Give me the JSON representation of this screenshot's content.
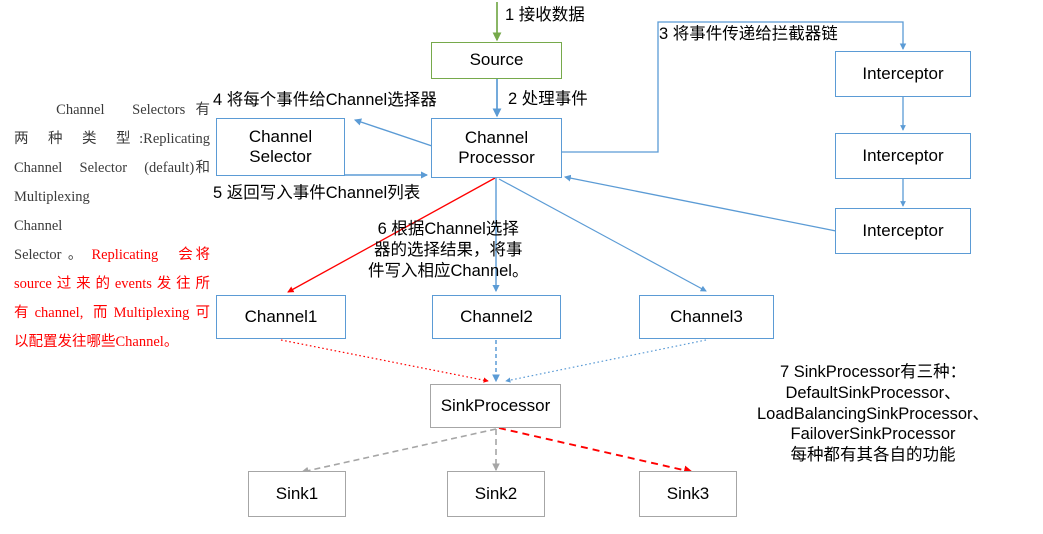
{
  "diagram": {
    "title": "Flume Agent Event Flow",
    "colors": {
      "blue": "#5b9bd5",
      "green": "#76a94b",
      "gray": "#a6a6a6",
      "red": "#ff0000",
      "text": "#000000"
    },
    "nodes": {
      "source": "Source",
      "channel_selector": "Channel\nSelector",
      "channel_processor": "Channel\nProcessor",
      "interceptor1": "Interceptor",
      "interceptor2": "Interceptor",
      "interceptor3": "Interceptor",
      "channel1": "Channel1",
      "channel2": "Channel2",
      "channel3": "Channel3",
      "sink_processor": "SinkProcessor",
      "sink1": "Sink1",
      "sink2": "Sink2",
      "sink3": "Sink3"
    },
    "step_labels": {
      "step1": "1 接收数据",
      "step2": "2 处理事件",
      "step3": "3 将事件传递给拦截器链",
      "step4": "4 将每个事件给Channel选择器",
      "step5": "5 返回写入事件Channel列表",
      "step6": "6 根据Channel选择\n器的选择结果，将事\n件写入相应Channel。",
      "step7": "7 SinkProcessor有三种：\nDefaultSinkProcessor、\nLoadBalancingSinkProcessor、\nFailoverSinkProcessor\n每种都有其各自的功能"
    },
    "side_note": {
      "line1_black": "　　Channel　Selectors 有",
      "line2_black": "两　种　类　型 :Replicating",
      "line3_black": "Channel　Selector　(default)和",
      "line4_black": "Multiplexing　　　　　Channel",
      "line5_mixed_black": "Selector 。 ",
      "line5_mixed_red": "Replicating　会将",
      "line6_red": "source过来的events发往所",
      "line7_red": "有channel, 而Multiplexing可",
      "line8_red": "以配置发往哪些Channel。"
    }
  }
}
